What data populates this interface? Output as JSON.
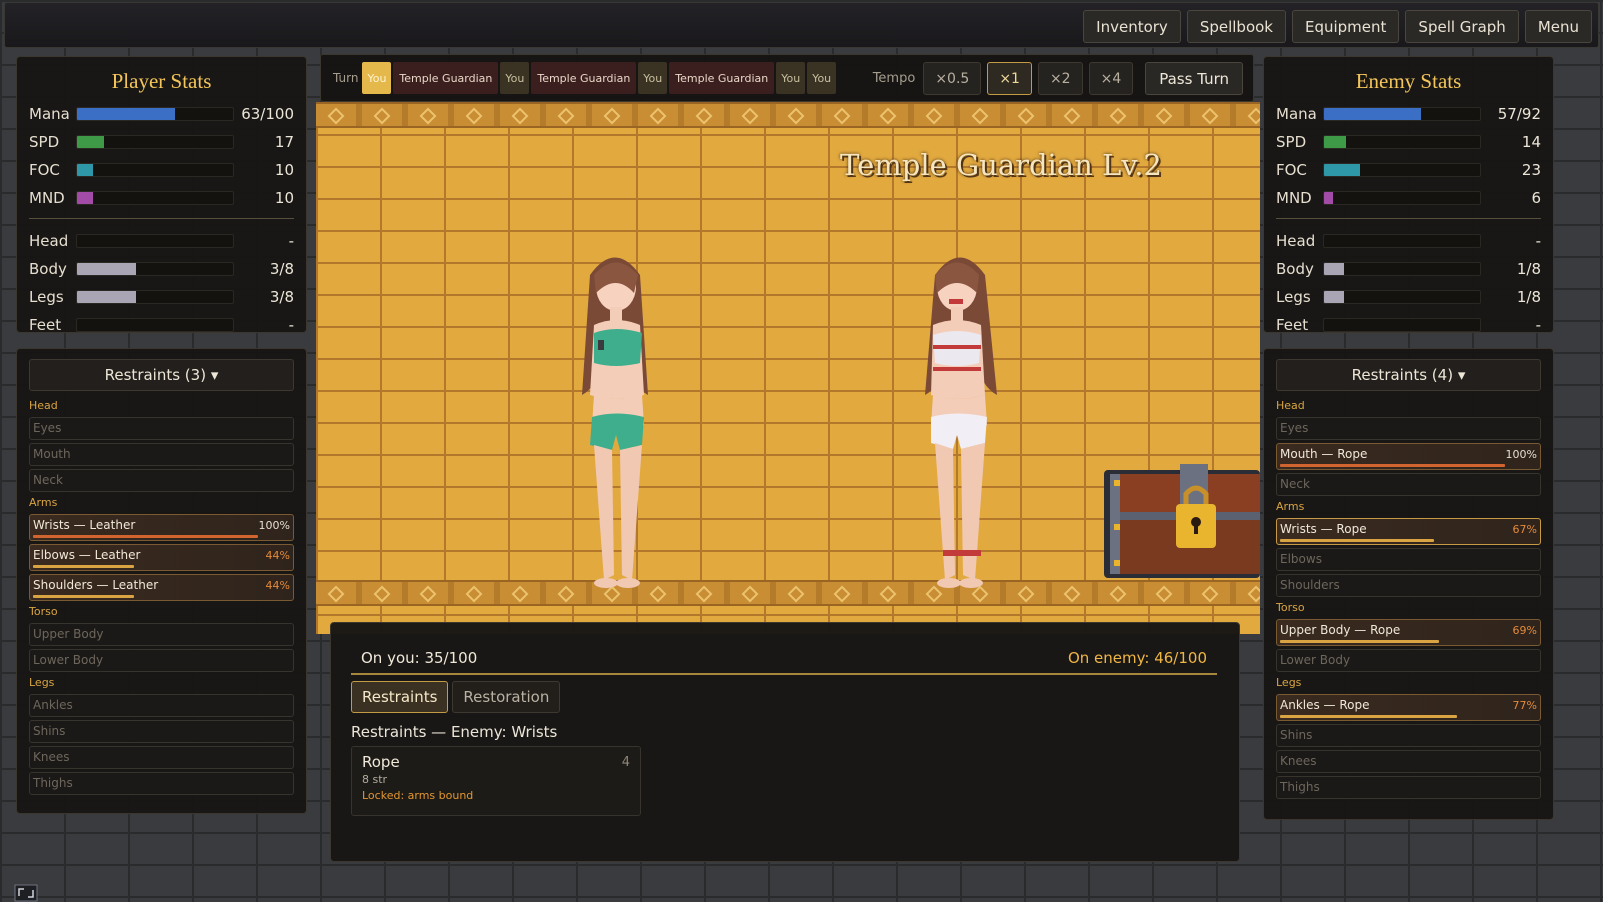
{
  "menu": [
    "Inventory",
    "Spellbook",
    "Equipment",
    "Spell Graph",
    "Menu"
  ],
  "turn": {
    "label": "Turn",
    "order": [
      {
        "name": "You",
        "who": "you",
        "active": true
      },
      {
        "name": "Temple Guardian",
        "who": "enemy"
      },
      {
        "name": "You",
        "who": "you"
      },
      {
        "name": "Temple Guardian",
        "who": "enemy"
      },
      {
        "name": "You",
        "who": "you"
      },
      {
        "name": "Temple Guardian",
        "who": "enemy"
      },
      {
        "name": "You",
        "who": "you"
      },
      {
        "name": "You",
        "who": "you"
      }
    ],
    "tempo_label": "Tempo",
    "tempo_options": [
      "×0.5",
      "×1",
      "×2",
      "×4"
    ],
    "tempo_selected": 1,
    "pass_label": "Pass Turn"
  },
  "player": {
    "title": "Player Stats",
    "stats": [
      {
        "label": "Mana",
        "value": "63/100",
        "fill": 0.63,
        "color": "#3b6fc6"
      },
      {
        "label": "SPD",
        "value": "17",
        "fill": 0.17,
        "color": "#3f9a48"
      },
      {
        "label": "FOC",
        "value": "10",
        "fill": 0.1,
        "color": "#2f98a8"
      },
      {
        "label": "MND",
        "value": "10",
        "fill": 0.1,
        "color": "#a24ba7"
      }
    ],
    "armor": [
      {
        "label": "Head",
        "value": "-",
        "fill": 0,
        "color": "#a9a5b5"
      },
      {
        "label": "Body",
        "value": "3/8",
        "fill": 0.375,
        "color": "#a9a5b5"
      },
      {
        "label": "Legs",
        "value": "3/8",
        "fill": 0.375,
        "color": "#a9a5b5"
      },
      {
        "label": "Feet",
        "value": "-",
        "fill": 0,
        "color": "#a9a5b5"
      }
    ],
    "restraints_title": "Restraints (3) ▾",
    "restraints": [
      {
        "type": "group",
        "label": "Head"
      },
      {
        "type": "slot",
        "label": "Eyes"
      },
      {
        "type": "slot",
        "label": "Mouth"
      },
      {
        "type": "slot",
        "label": "Neck"
      },
      {
        "type": "group",
        "label": "Arms"
      },
      {
        "type": "slot",
        "label": "Wrists — Leather",
        "pct": "100%",
        "fill": 0.98,
        "filled": true,
        "warn": false
      },
      {
        "type": "slot",
        "label": "Elbows — Leather",
        "pct": "44%",
        "fill": 0.44,
        "filled": true,
        "warn": true
      },
      {
        "type": "slot",
        "label": "Shoulders — Leather",
        "pct": "44%",
        "fill": 0.44,
        "filled": true,
        "warn": true
      },
      {
        "type": "group",
        "label": "Torso"
      },
      {
        "type": "slot",
        "label": "Upper Body"
      },
      {
        "type": "slot",
        "label": "Lower Body"
      },
      {
        "type": "group",
        "label": "Legs"
      },
      {
        "type": "slot",
        "label": "Ankles"
      },
      {
        "type": "slot",
        "label": "Shins"
      },
      {
        "type": "slot",
        "label": "Knees"
      },
      {
        "type": "slot",
        "label": "Thighs"
      }
    ]
  },
  "enemy": {
    "title": "Enemy Stats",
    "name": "Temple Guardian Lv.2",
    "stats": [
      {
        "label": "Mana",
        "value": "57/92",
        "fill": 0.62,
        "color": "#3b6fc6"
      },
      {
        "label": "SPD",
        "value": "14",
        "fill": 0.14,
        "color": "#3f9a48"
      },
      {
        "label": "FOC",
        "value": "23",
        "fill": 0.23,
        "color": "#2f98a8"
      },
      {
        "label": "MND",
        "value": "6",
        "fill": 0.06,
        "color": "#a24ba7"
      }
    ],
    "armor": [
      {
        "label": "Head",
        "value": "-",
        "fill": 0,
        "color": "#a9a5b5"
      },
      {
        "label": "Body",
        "value": "1/8",
        "fill": 0.125,
        "color": "#a9a5b5"
      },
      {
        "label": "Legs",
        "value": "1/8",
        "fill": 0.125,
        "color": "#a9a5b5"
      },
      {
        "label": "Feet",
        "value": "-",
        "fill": 0,
        "color": "#a9a5b5"
      }
    ],
    "restraints_title": "Restraints (4) ▾",
    "restraints": [
      {
        "type": "group",
        "label": "Head"
      },
      {
        "type": "slot",
        "label": "Eyes"
      },
      {
        "type": "slot",
        "label": "Mouth — Rope",
        "pct": "100%",
        "fill": 0.98,
        "filled": true,
        "warn": false
      },
      {
        "type": "slot",
        "label": "Neck"
      },
      {
        "type": "group",
        "label": "Arms"
      },
      {
        "type": "slot",
        "label": "Wrists — Rope",
        "pct": "67%",
        "fill": 0.67,
        "filled": true,
        "warn": true,
        "hl": true
      },
      {
        "type": "slot",
        "label": "Elbows"
      },
      {
        "type": "slot",
        "label": "Shoulders"
      },
      {
        "type": "group",
        "label": "Torso"
      },
      {
        "type": "slot",
        "label": "Upper Body — Rope",
        "pct": "69%",
        "fill": 0.69,
        "filled": true,
        "warn": true
      },
      {
        "type": "slot",
        "label": "Lower Body"
      },
      {
        "type": "group",
        "label": "Legs"
      },
      {
        "type": "slot",
        "label": "Ankles — Rope",
        "pct": "77%",
        "fill": 0.77,
        "filled": true,
        "warn": true
      },
      {
        "type": "slot",
        "label": "Shins"
      },
      {
        "type": "slot",
        "label": "Knees"
      },
      {
        "type": "slot",
        "label": "Thighs"
      }
    ]
  },
  "casting": {
    "on_you": "On you: 35/100",
    "on_enemy": "On enemy: 46/100"
  },
  "tabs": [
    "Restraints",
    "Restoration"
  ],
  "active_tab": 0,
  "subhead": "Restraints — Enemy: Wrists",
  "spell_card": {
    "name": "Rope",
    "cost": "4",
    "str": "8 str",
    "lock": "Locked: arms bound"
  }
}
